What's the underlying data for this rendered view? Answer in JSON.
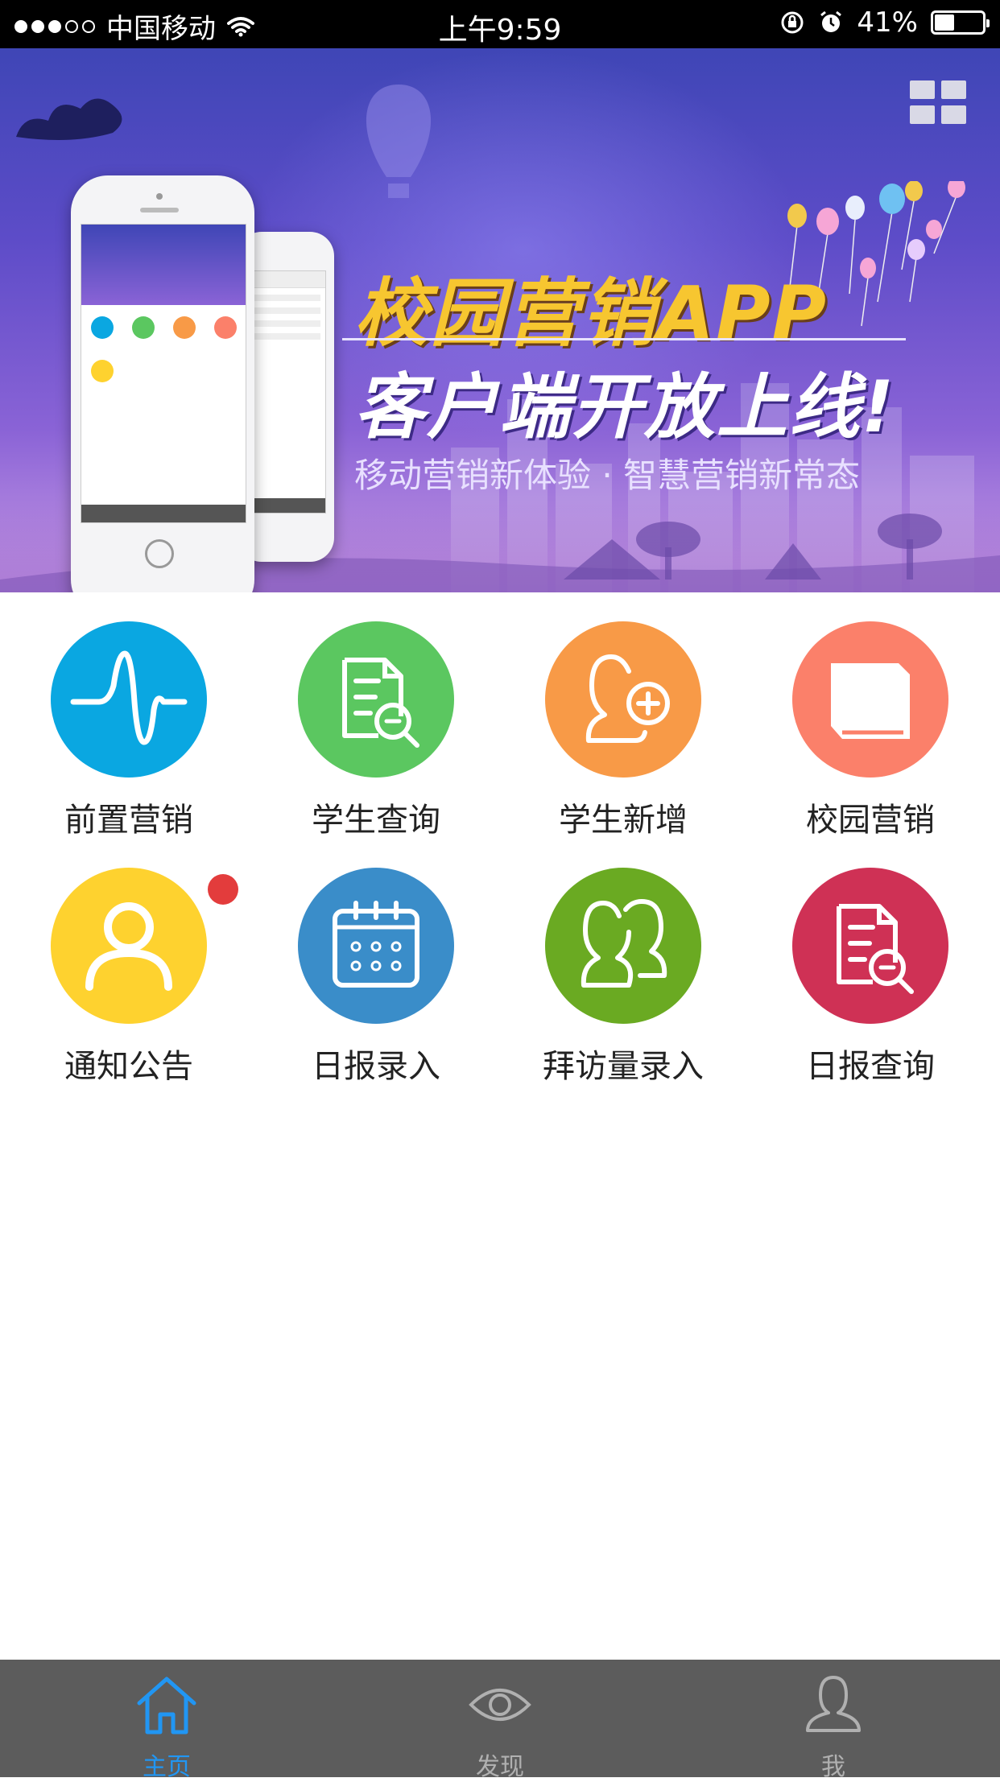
{
  "status_bar": {
    "carrier": "中国移动",
    "time": "上午9:59",
    "battery_percent": "41%",
    "battery_level": 0.41,
    "signal_bars_filled": 3,
    "signal_bars_total": 5,
    "icons": [
      "wifi-icon",
      "orientation-lock-icon",
      "alarm-icon",
      "battery-icon"
    ]
  },
  "banner": {
    "title": "校园营销APP",
    "subtitle": "客户端开放上线!",
    "tagline": "移动营销新体验 · 智慧营销新常态",
    "grid_icon": "grid-icon",
    "colors": {
      "title": "#f7c630",
      "background_top": "#3f46b6",
      "background_bottom": "#c89ae5"
    }
  },
  "menu": {
    "items": [
      {
        "label": "前置营销",
        "icon": "waveform-icon",
        "color": "#0aa7e1",
        "badge": false
      },
      {
        "label": "学生查询",
        "icon": "document-search-icon",
        "color": "#5bc760",
        "badge": false
      },
      {
        "label": "学生新增",
        "icon": "add-person-icon",
        "color": "#f89a47",
        "badge": false
      },
      {
        "label": "校园营销",
        "icon": "book-icon",
        "color": "#fb806a",
        "badge": false
      },
      {
        "label": "通知公告",
        "icon": "person-icon",
        "color": "#fed22f",
        "badge": true
      },
      {
        "label": "日报录入",
        "icon": "calendar-icon",
        "color": "#3a8dc9",
        "badge": false
      },
      {
        "label": "拜访量录入",
        "icon": "people-icon",
        "color": "#6aaa22",
        "badge": false
      },
      {
        "label": "日报查询",
        "icon": "document-search-icon",
        "color": "#cf3155",
        "badge": false
      }
    ],
    "badge_color": "#e33c3c"
  },
  "tab_bar": {
    "tabs": [
      {
        "label": "主页",
        "icon": "home-icon",
        "active": true
      },
      {
        "label": "发现",
        "icon": "eye-icon",
        "active": false
      },
      {
        "label": "我",
        "icon": "profile-icon",
        "active": false
      }
    ],
    "active_color": "#2196f3",
    "inactive_color": "#b0b0b0",
    "background": "#5c5c5c"
  }
}
